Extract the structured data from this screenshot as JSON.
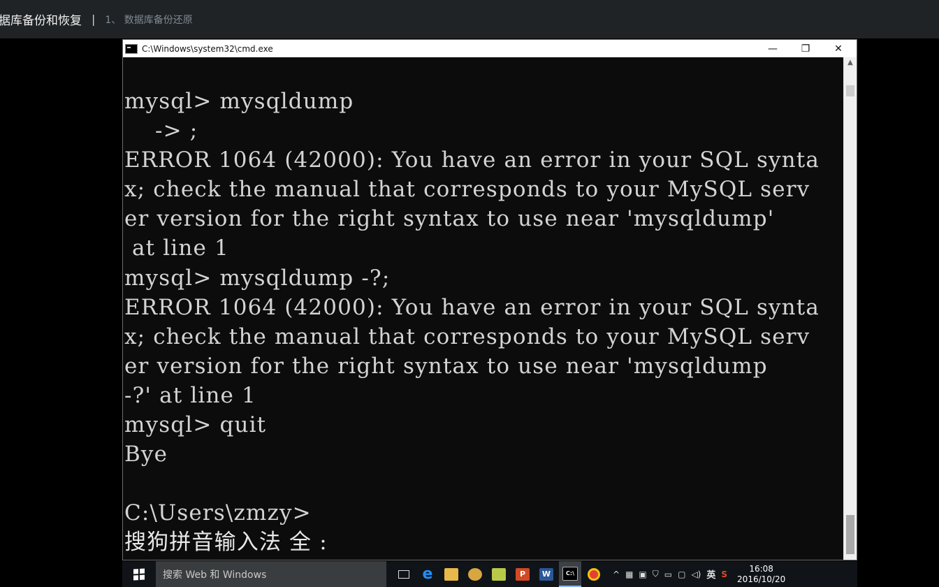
{
  "topbar": {
    "course_title": "据库备份和恢复",
    "separator": "|",
    "lesson_title": "1、 数据库备份还原"
  },
  "window": {
    "title": "C:\\Windows\\system32\\cmd.exe",
    "controls": {
      "minimize": "—",
      "restore": "❐",
      "close": "✕"
    }
  },
  "console": {
    "lines": [
      "mysql> mysqldump",
      "    -> ;",
      "ERROR 1064 (42000): You have an error in your SQL synta",
      "x; check the manual that corresponds to your MySQL serv",
      "er version for the right syntax to use near 'mysqldump'",
      " at line 1",
      "mysql> mysqldump -?;",
      "ERROR 1064 (42000): You have an error in your SQL synta",
      "x; check the manual that corresponds to your MySQL serv",
      "er version for the right syntax to use near 'mysqldump",
      "-?' at line 1",
      "mysql> quit",
      "Bye",
      "",
      "C:\\Users\\zmzy>"
    ],
    "ime_status": "搜狗拼音输入法 全 :"
  },
  "taskbar": {
    "search_placeholder": "搜索 Web 和 Windows",
    "ime_lang": "英",
    "time": "16:08",
    "date": "2016/10/20"
  },
  "colors": {
    "console_bg": "#0c0c0c",
    "console_text": "#d4d4d4",
    "taskbar_bg": "#101418",
    "topbar_bg": "#1f2326"
  }
}
